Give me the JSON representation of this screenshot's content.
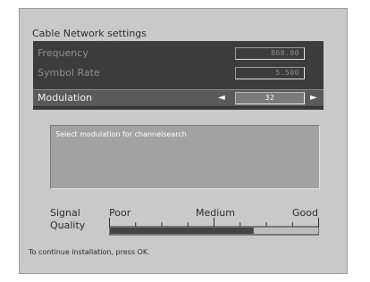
{
  "title": "Cable Network settings",
  "menu": {
    "rows": [
      {
        "label": "Frequency",
        "value": "868.00"
      },
      {
        "label": "Symbol Rate",
        "value": "5.500"
      },
      {
        "label": "Modulation",
        "value": "32",
        "selected": true
      }
    ],
    "arrow_left": "◄",
    "arrow_right": "►"
  },
  "help_text": "Select modulation for channelsearch",
  "signal": {
    "label_line1": "Signal",
    "label_line2": "Quality",
    "scale": [
      "Poor",
      "Medium",
      "Good"
    ],
    "level_percent": 69
  },
  "footer": "To continue installation, press OK.",
  "colors": {
    "panel": "#c9c9c9",
    "menu_bg": "#3c3c3c",
    "selected_row": "#5a5a5a",
    "help_bg": "#a2a2a2",
    "bar_fill": "#444444"
  }
}
